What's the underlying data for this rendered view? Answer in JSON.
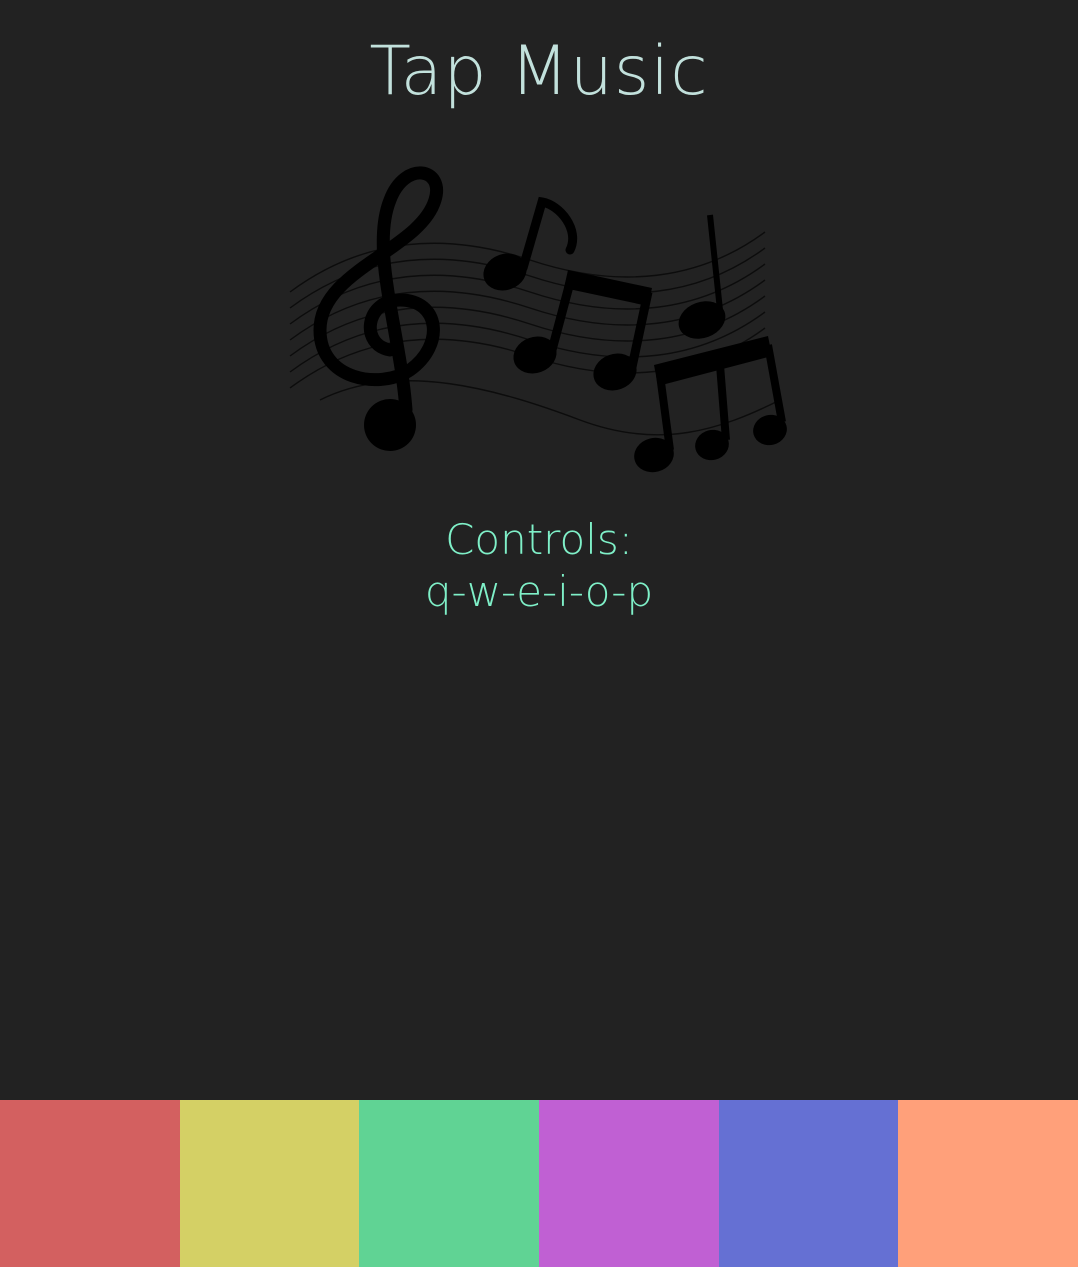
{
  "header": {
    "title": "Tap Music"
  },
  "illustration": {
    "icon": "music-notes-icon"
  },
  "controls": {
    "label": "Controls:",
    "keys": "q-w-e-i-o-p"
  },
  "pads": [
    {
      "key": "q",
      "color": "#d36060"
    },
    {
      "key": "w",
      "color": "#d4d065"
    },
    {
      "key": "e",
      "color": "#60d394"
    },
    {
      "key": "i",
      "color": "#c060d3"
    },
    {
      "key": "o",
      "color": "#6570d3"
    },
    {
      "key": "p",
      "color": "#ffa07a"
    }
  ]
}
